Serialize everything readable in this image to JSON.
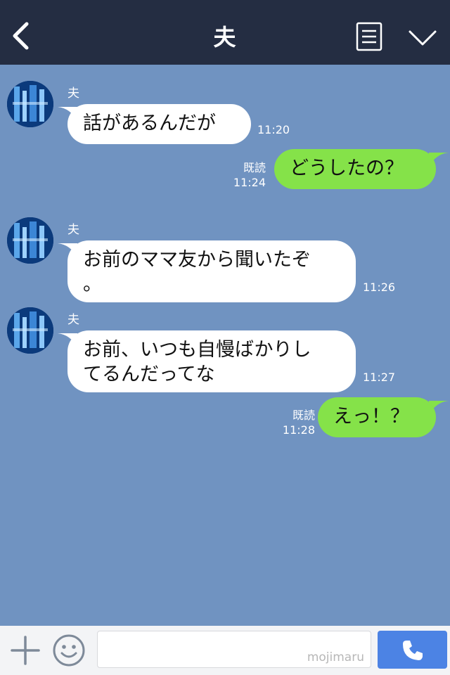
{
  "header": {
    "title": "夫"
  },
  "messages": [
    {
      "sender": "夫",
      "text": "話があるんだが",
      "time": "11:20"
    },
    {
      "read": "既読",
      "text": "どうしたの？",
      "time": "11:24"
    },
    {
      "sender": "夫",
      "text_lines": [
        "お前のママ友から聞いたぞ",
        "。"
      ],
      "time": "11:26"
    },
    {
      "sender": "夫",
      "text_lines": [
        "お前、いつも自慢ばかりし",
        "てるんだってな"
      ],
      "time": "11:27"
    },
    {
      "read": "既読",
      "text": "えっ！？",
      "time": "11:28"
    }
  ],
  "footer": {
    "watermark": "mojimaru"
  },
  "colors": {
    "header_bg": "#242d42",
    "chat_bg": "#7093c1",
    "incoming_bubble": "#ffffff",
    "outgoing_bubble": "#85e249",
    "call_button": "#4c83e4"
  },
  "icons": [
    "back-arrow-icon",
    "menu-list-icon",
    "chevron-down-icon",
    "plus-icon",
    "smile-icon",
    "phone-icon",
    "avatar"
  ]
}
